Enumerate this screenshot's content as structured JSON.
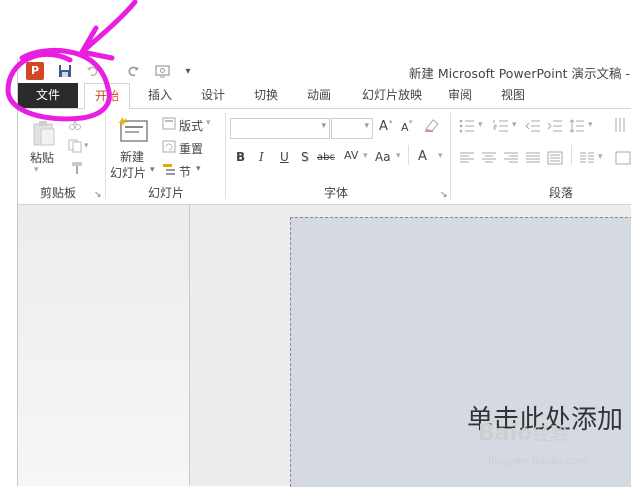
{
  "title_bar": {
    "app_icon": "powerpoint-icon",
    "app_icon_text": "P",
    "document_title": "新建 Microsoft PowerPoint 演示文稿 -",
    "qat": [
      {
        "name": "save-icon"
      },
      {
        "name": "undo-icon"
      },
      {
        "name": "redo-icon"
      },
      {
        "name": "present-from-start-icon"
      },
      {
        "name": "customize-qat-icon",
        "glyph": "▾"
      }
    ]
  },
  "tabs": [
    {
      "name": "tab-file",
      "label": "文件"
    },
    {
      "name": "tab-home",
      "label": "开始"
    },
    {
      "name": "tab-insert",
      "label": "插入"
    },
    {
      "name": "tab-design",
      "label": "设计"
    },
    {
      "name": "tab-transitions",
      "label": "切换"
    },
    {
      "name": "tab-animations",
      "label": "动画"
    },
    {
      "name": "tab-slideshow",
      "label": "幻灯片放映"
    },
    {
      "name": "tab-review",
      "label": "审阅"
    },
    {
      "name": "tab-view",
      "label": "视图"
    }
  ],
  "ribbon": {
    "clipboard": {
      "label": "剪贴板",
      "paste_label": "粘贴"
    },
    "slides": {
      "label": "幻灯片",
      "new_slide_line1": "新建",
      "new_slide_line2": "幻灯片",
      "layout_label": "版式",
      "reset_label": "重置",
      "section_label": "节"
    },
    "font": {
      "label": "字体",
      "bold": "B",
      "italic": "I",
      "underline": "U",
      "shadow": "S",
      "strikethrough": "abc",
      "char_spacing": "AV",
      "change_case": "Aa",
      "font_color": "A",
      "grow": "A",
      "shrink": "A"
    },
    "paragraph": {
      "label": "段落"
    }
  },
  "slide": {
    "placeholder": "单击此处添加"
  },
  "watermark": {
    "logo_text": "Bai",
    "logo_text2": "经验",
    "url": "jingyan.baidu.com"
  },
  "colors": {
    "accent": "#d24726",
    "file_tab": "#2b2b2b",
    "annotation": "#e81ee0",
    "slide_bg": "#d4d9e2"
  }
}
